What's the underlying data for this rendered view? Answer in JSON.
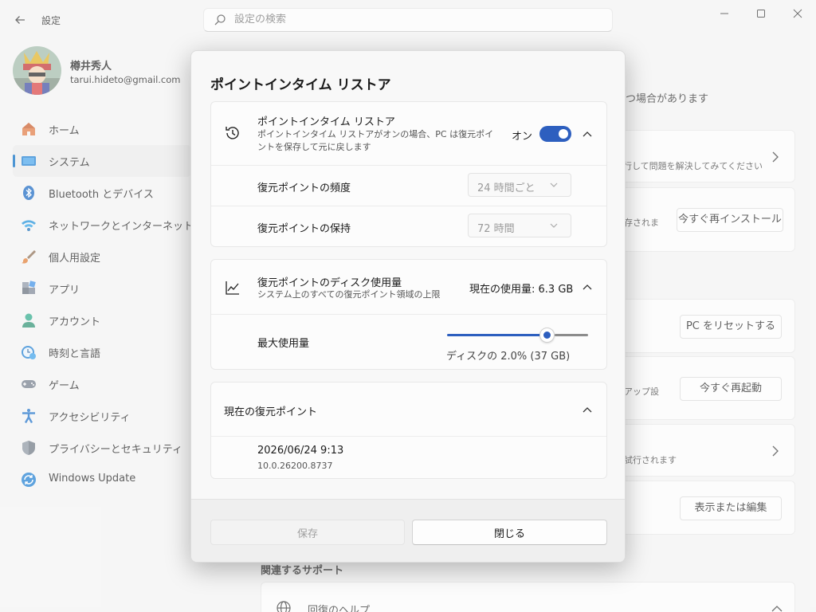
{
  "app": {
    "title": "設定"
  },
  "search": {
    "placeholder": "設定の検索"
  },
  "profile": {
    "name": "樽井秀人",
    "email": "tarui.hideto@gmail.com"
  },
  "sidebar": {
    "items": [
      {
        "label": "ホーム",
        "icon": "home-icon"
      },
      {
        "label": "システム",
        "icon": "system-icon",
        "active": true
      },
      {
        "label": "Bluetooth とデバイス",
        "icon": "bluetooth-icon"
      },
      {
        "label": "ネットワークとインターネット",
        "icon": "network-icon"
      },
      {
        "label": "個人用設定",
        "icon": "personalization-icon"
      },
      {
        "label": "アプリ",
        "icon": "apps-icon"
      },
      {
        "label": "アカウント",
        "icon": "accounts-icon"
      },
      {
        "label": "時刻と言語",
        "icon": "time-language-icon"
      },
      {
        "label": "ゲーム",
        "icon": "gaming-icon"
      },
      {
        "label": "アクセシビリティ",
        "icon": "accessibility-icon"
      },
      {
        "label": "プライバシーとセキュリティ",
        "icon": "privacy-shield-icon"
      },
      {
        "label": "Windows Update",
        "icon": "windows-update-icon"
      }
    ]
  },
  "background": {
    "partial_line1": "つ場合があります",
    "card1_sub": "行して問題を解決してみてください",
    "card2_sub": "存されま",
    "reinstall_button": "今すぐ再インストール",
    "reset_button": "PC をリセットする",
    "card4_sub": "アップ設",
    "restart_button": "今すぐ再起動",
    "card5_sub": "試行されます",
    "view_edit_button": "表示または編集",
    "related_support": "関連するサポート",
    "help_partial": "回復のヘルプ"
  },
  "dialog": {
    "title": "ポイントインタイム リストア",
    "pitr": {
      "title": "ポイントインタイム リストア",
      "description": "ポイントインタイム リストアがオンの場合、PC は復元ポイントを保存して元に戻します",
      "toggle_label": "オン",
      "toggle_on": true
    },
    "frequency": {
      "label": "復元ポイントの頻度",
      "value": "24 時間ごと"
    },
    "retention": {
      "label": "復元ポイントの保持",
      "value": "72 時間"
    },
    "disk": {
      "title": "復元ポイントのディスク使用量",
      "description": "システム上のすべての復元ポイント領域の上限",
      "current_usage": "現在の使用量: 6.3 GB"
    },
    "max_usage": {
      "label": "最大使用量",
      "caption": "ディスクの 2.0% (37 GB)",
      "slider_fraction": 0.72
    },
    "current_points": {
      "title": "現在の復元ポイント",
      "items": [
        {
          "date": "2026/06/24 9:13",
          "version": "10.0.26200.8737"
        }
      ]
    },
    "buttons": {
      "save": "保存",
      "close": "閉じる"
    }
  },
  "colors": {
    "accent": "#2d5fbf",
    "nav_indicator": "#0067c0"
  }
}
